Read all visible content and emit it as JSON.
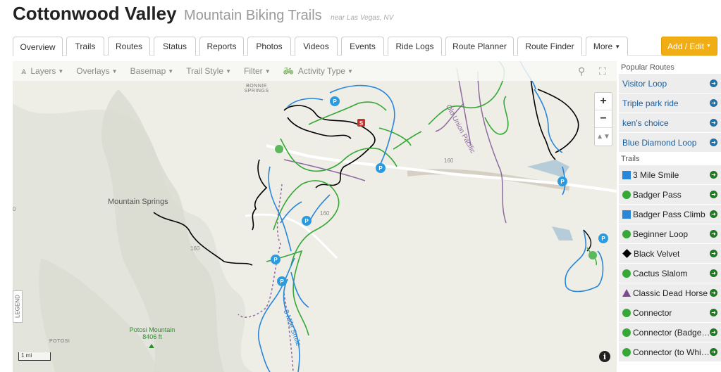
{
  "header": {
    "title": "Cottonwood Valley",
    "subtitle": "Mountain Biking Trails",
    "near": "near Las Vegas, NV"
  },
  "tabs": [
    {
      "label": "Overview",
      "active": true
    },
    {
      "label": "Trails"
    },
    {
      "label": "Routes"
    },
    {
      "label": "Status"
    },
    {
      "label": "Reports"
    },
    {
      "label": "Photos"
    },
    {
      "label": "Videos"
    },
    {
      "label": "Events"
    },
    {
      "label": "Ride Logs"
    },
    {
      "label": "Route Planner"
    },
    {
      "label": "Route Finder"
    },
    {
      "label": "More"
    }
  ],
  "add_edit_label": "Add / Edit",
  "map": {
    "toolbar": {
      "layers": "Layers",
      "overlays": "Overlays",
      "basemap": "Basemap",
      "trail_style": "Trail Style",
      "filter": "Filter",
      "activity_type": "Activity Type"
    },
    "labels": {
      "bonnie_springs": "BONNIE SPRINGS",
      "mountain_springs": "Mountain Springs",
      "potosi": "POTOSI",
      "potosi_mountain": "Potosi Mountain",
      "potosi_elevation": "8406 ft",
      "road_160_a": "160",
      "road_160_b": "160",
      "road_160_c": "160",
      "old_union_pacific": "Old Union Pacific",
      "trail_label": "3 Mile Smile",
      "label_0": "0"
    },
    "legend_label": "LEGEND",
    "scale_label": "1 mi",
    "zoom_in": "+",
    "zoom_out": "−",
    "info": "i"
  },
  "panel": {
    "popular_routes_heading": "Popular Routes",
    "routes": [
      {
        "name": "Visitor Loop"
      },
      {
        "name": "Triple park ride"
      },
      {
        "name": "ken's choice"
      },
      {
        "name": "Blue Diamond Loop"
      }
    ],
    "trails_heading": "Trails",
    "trails": [
      {
        "name": "3 Mile Smile",
        "difficulty": "blue"
      },
      {
        "name": "Badger Pass",
        "difficulty": "green"
      },
      {
        "name": "Badger Pass Climb",
        "difficulty": "blue"
      },
      {
        "name": "Beginner Loop",
        "difficulty": "green"
      },
      {
        "name": "Black Velvet",
        "difficulty": "black"
      },
      {
        "name": "Cactus Slalom",
        "difficulty": "green"
      },
      {
        "name": "Classic Dead Horse",
        "difficulty": "purple"
      },
      {
        "name": "Connector",
        "difficulty": "green"
      },
      {
        "name": "Connector (Badger Pass)",
        "difficulty": "green"
      },
      {
        "name": "Connector (to Whitney)",
        "difficulty": "green"
      }
    ]
  },
  "colors": {
    "accent_orange": "#f0ad15",
    "route_blue": "#1a5d9a",
    "trail_blue": "#2a86d8",
    "trail_green": "#36a836",
    "trail_black": "#000000",
    "trail_purple": "#7b4a8f"
  }
}
